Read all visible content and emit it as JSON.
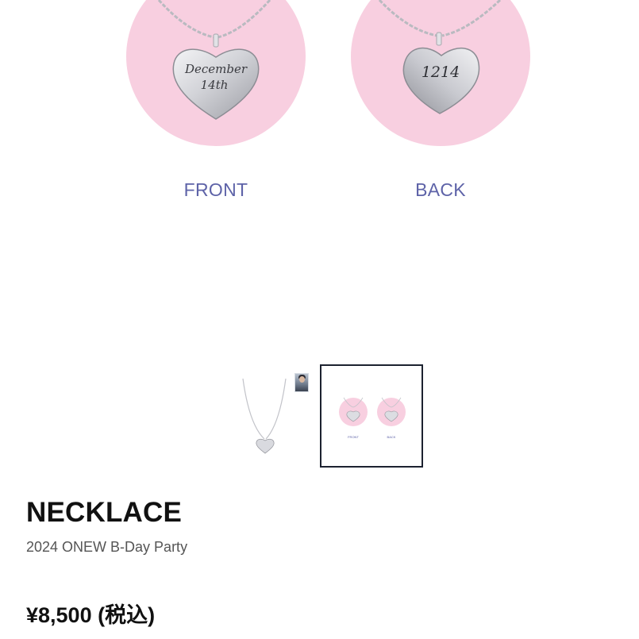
{
  "main_image": {
    "front_label": "FRONT",
    "back_label": "BACK",
    "front_engraving_line1": "December",
    "front_engraving_line2": "14th",
    "back_engraving": "1214"
  },
  "thumbnail_selected": {
    "front_label": "FRONT",
    "back_label": "BACK"
  },
  "product": {
    "title": "NECKLACE",
    "subtitle": "2024 ONEW B-Day Party",
    "price": "¥8,500 (税込)"
  },
  "colors": {
    "circle_pink": "#f8cfe0",
    "label_purple": "#5e63a8",
    "thumb_border": "#1c2230"
  }
}
